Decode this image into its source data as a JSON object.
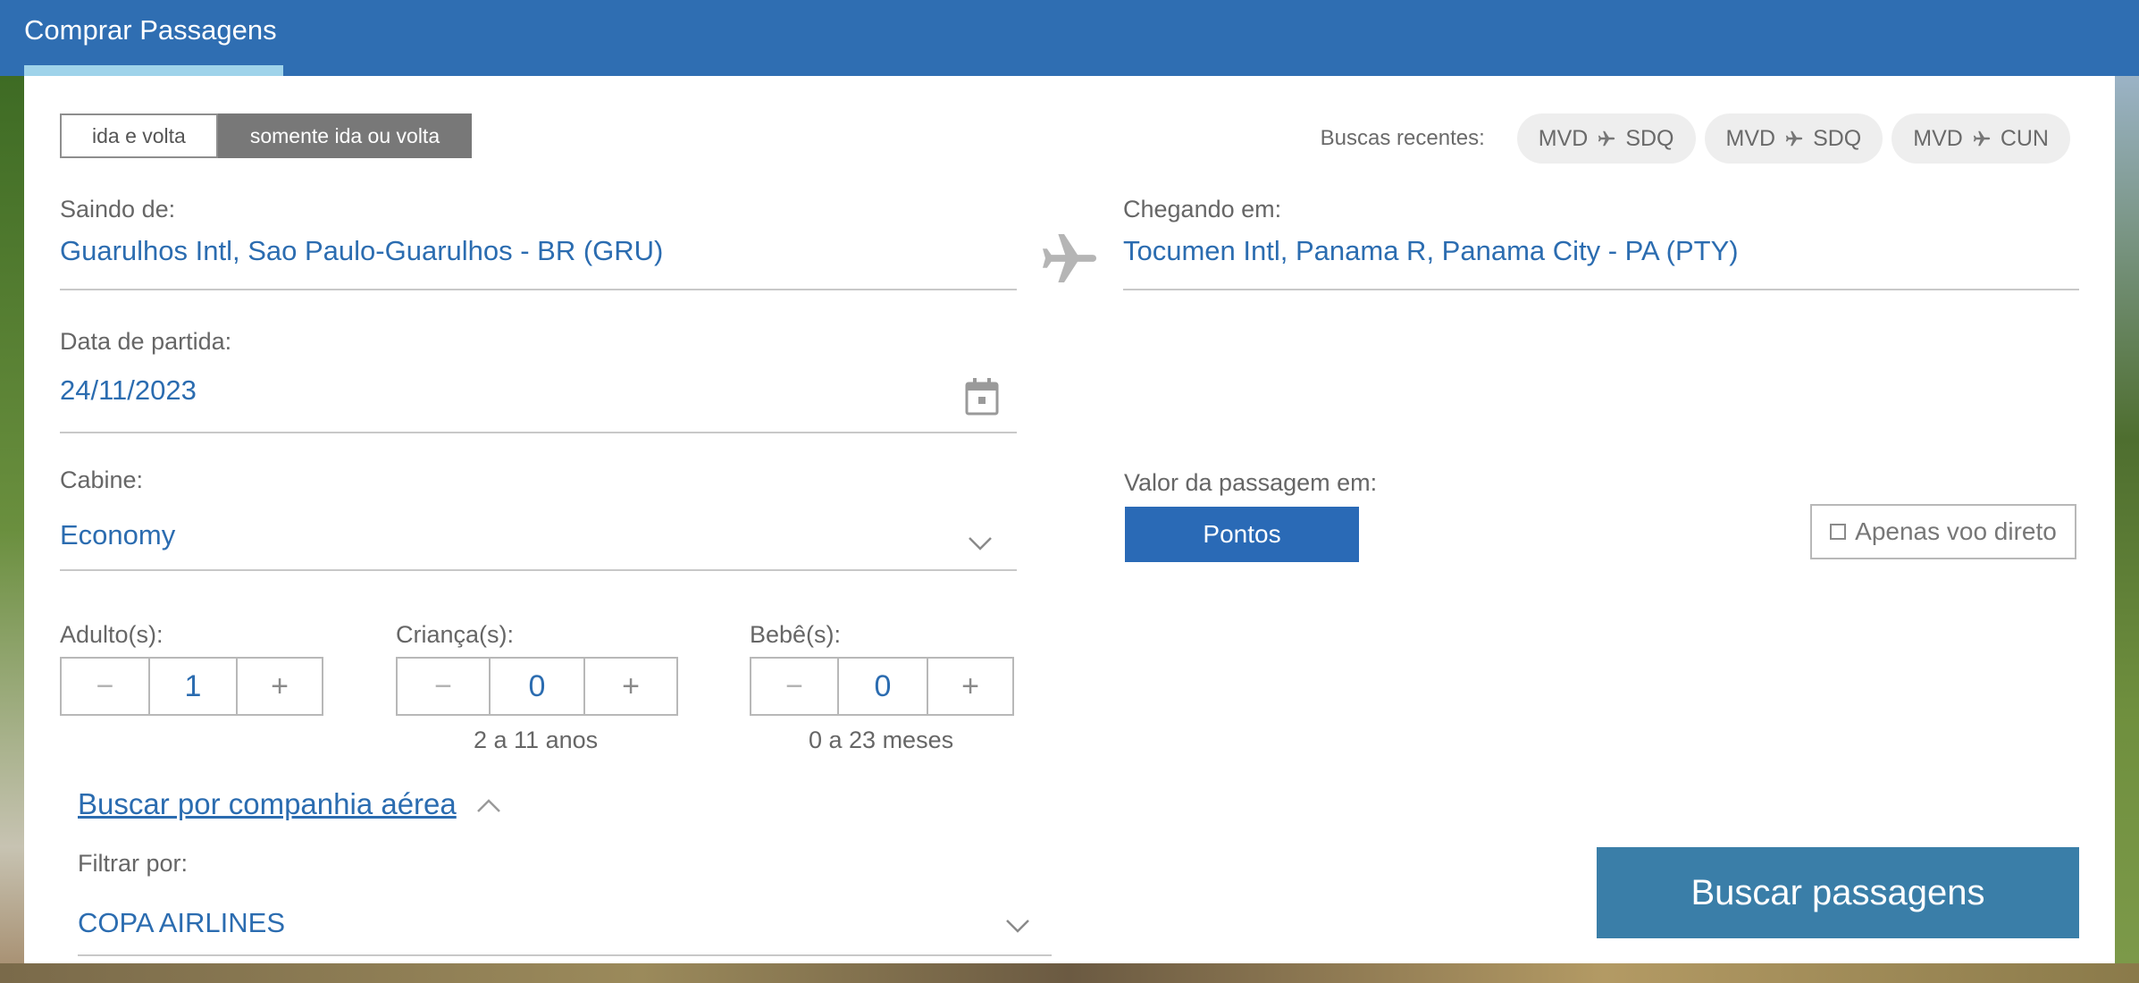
{
  "header": {
    "title": "Comprar Passagens"
  },
  "trip_type": {
    "round_trip": "ida e volta",
    "one_way": "somente ida ou volta",
    "selected": "somente ida ou volta"
  },
  "recent": {
    "label": "Buscas recentes:",
    "items": [
      {
        "from": "MVD",
        "to": "SDQ"
      },
      {
        "from": "MVD",
        "to": "SDQ"
      },
      {
        "from": "MVD",
        "to": "CUN"
      }
    ]
  },
  "origin": {
    "label": "Saindo de:",
    "value": "Guarulhos Intl, Sao Paulo-Guarulhos - BR (GRU)"
  },
  "destination": {
    "label": "Chegando em:",
    "value": "Tocumen Intl, Panama R, Panama City - PA (PTY)"
  },
  "departure": {
    "label": "Data de partida:",
    "value": "24/11/2023"
  },
  "cabin": {
    "label": "Cabine:",
    "value": "Economy"
  },
  "currency": {
    "label": "Valor da passagem em:",
    "button": "Pontos"
  },
  "direct": {
    "label": "Apenas voo direto",
    "checked": false
  },
  "passengers": {
    "adults": {
      "label": "Adulto(s):",
      "value": "1",
      "hint": ""
    },
    "children": {
      "label": "Criança(s):",
      "value": "0",
      "hint": "2 a 11 anos"
    },
    "infants": {
      "label": "Bebê(s):",
      "value": "0",
      "hint": "0 a 23 meses"
    },
    "minus": "−",
    "plus": "+"
  },
  "airline": {
    "link": "Buscar por companhia aérea",
    "filter_label": "Filtrar por:",
    "value": "COPA AIRLINES"
  },
  "search_button": "Buscar passagens",
  "colors": {
    "header": "#2f6eb2",
    "accent": "#2b6cb0",
    "search": "#3a7ea8"
  }
}
